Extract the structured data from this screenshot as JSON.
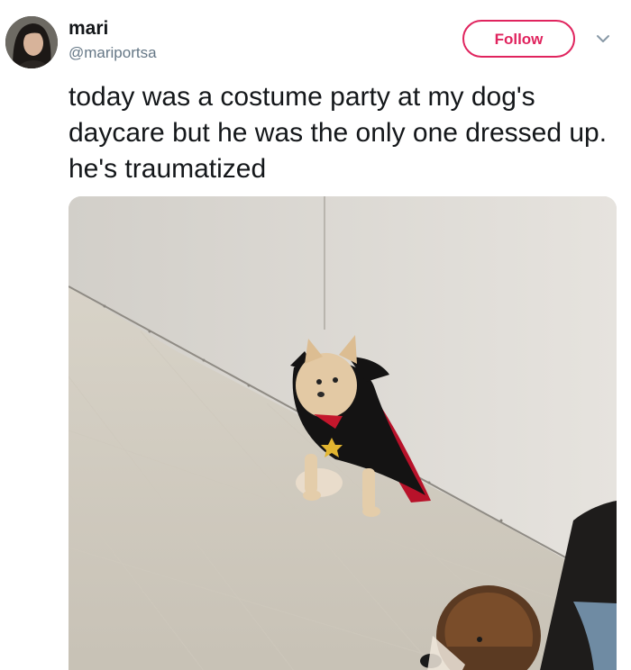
{
  "user": {
    "display_name": "mari",
    "handle": "@mariportsa"
  },
  "actions": {
    "follow_label": "Follow"
  },
  "tweet": {
    "text": "today was a costume party at my dog's daycare but he was the only one dressed up. he's traumatized"
  },
  "colors": {
    "accent": "#e0245e",
    "text_primary": "#14171a",
    "text_secondary": "#657786"
  },
  "icons": {
    "more_menu": "chevron-down-icon"
  }
}
